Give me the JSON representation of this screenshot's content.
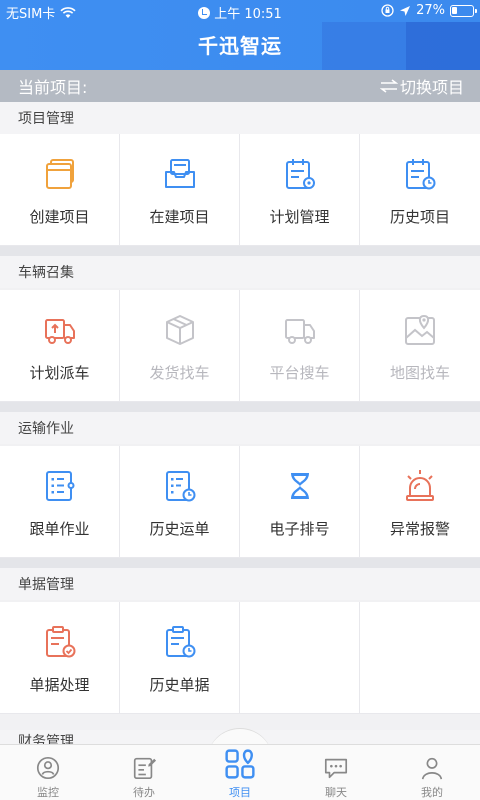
{
  "status_bar": {
    "carrier": "无SIM卡",
    "time": "上午 10:51",
    "battery": "27%"
  },
  "app": {
    "title": "千迅智运"
  },
  "project_bar": {
    "current_label": "当前项目:",
    "switch_label": "切换项目"
  },
  "sections": [
    {
      "title": "项目管理",
      "items": [
        {
          "label": "创建项目",
          "icon": "create-project-icon",
          "enabled": true
        },
        {
          "label": "在建项目",
          "icon": "ongoing-project-icon",
          "enabled": true
        },
        {
          "label": "计划管理",
          "icon": "plan-management-icon",
          "enabled": true
        },
        {
          "label": "历史项目",
          "icon": "history-project-icon",
          "enabled": true
        }
      ]
    },
    {
      "title": "车辆召集",
      "items": [
        {
          "label": "计划派车",
          "icon": "dispatch-truck-icon",
          "enabled": true
        },
        {
          "label": "发货找车",
          "icon": "package-box-icon",
          "enabled": false
        },
        {
          "label": "平台搜车",
          "icon": "truck-icon",
          "enabled": false
        },
        {
          "label": "地图找车",
          "icon": "map-pin-icon",
          "enabled": false
        }
      ]
    },
    {
      "title": "运输作业",
      "items": [
        {
          "label": "跟单作业",
          "icon": "tracking-list-icon",
          "enabled": true
        },
        {
          "label": "历史运单",
          "icon": "history-waybill-icon",
          "enabled": true
        },
        {
          "label": "电子排号",
          "icon": "hourglass-icon",
          "enabled": true
        },
        {
          "label": "异常报警",
          "icon": "alarm-light-icon",
          "enabled": true
        }
      ]
    },
    {
      "title": "单据管理",
      "items": [
        {
          "label": "单据处理",
          "icon": "document-process-icon",
          "enabled": true
        },
        {
          "label": "历史单据",
          "icon": "history-document-icon",
          "enabled": true
        }
      ]
    }
  ],
  "finance_section_title": "财务管理",
  "bottom_nav": [
    {
      "label": "监控",
      "icon": "monitor-icon",
      "active": false
    },
    {
      "label": "待办",
      "icon": "todo-icon",
      "active": false
    },
    {
      "label": "项目",
      "icon": "project-grid-icon",
      "active": true
    },
    {
      "label": "聊天",
      "icon": "chat-icon",
      "active": false
    },
    {
      "label": "我的",
      "icon": "user-icon",
      "active": false
    }
  ],
  "colors": {
    "primary": "#3f8ff2",
    "orange": "#f0a23c",
    "red": "#e8725a",
    "disabled": "#c4c4c9"
  }
}
